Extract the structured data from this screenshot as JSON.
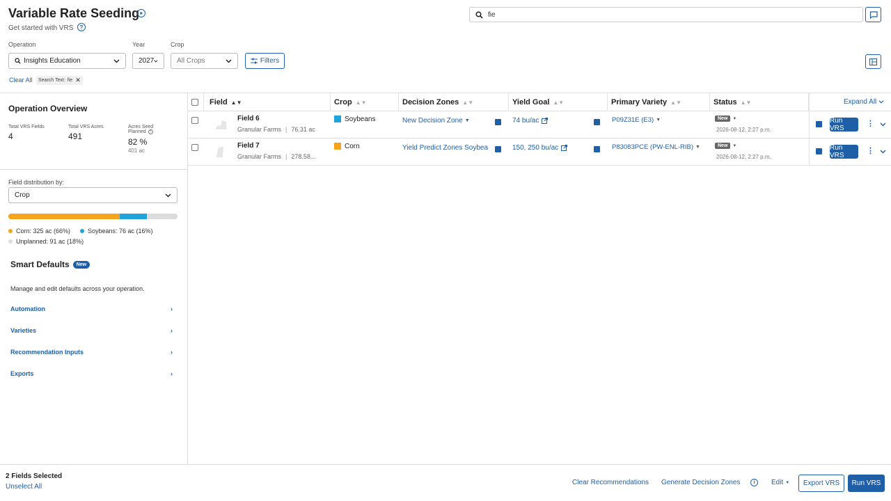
{
  "header": {
    "title": "Variable Rate Seeding",
    "subtitle": "Get started with VRS",
    "search_value": "fie"
  },
  "filters": {
    "operation_label": "Operation",
    "operation_value": "Insights Education",
    "year_label": "Year",
    "year_value": "2027",
    "crop_label": "Crop",
    "crop_value": "All Crops",
    "filters_button": "Filters",
    "clear_all": "Clear All",
    "chip_label": "Search Text:",
    "chip_value": "fie"
  },
  "overview": {
    "title": "Operation Overview",
    "stats": [
      {
        "label": "Total VRS Fields",
        "value": "4",
        "sub": ""
      },
      {
        "label": "Total VRS Acres",
        "value": "491",
        "sub": ""
      },
      {
        "label_1": "Acres Seed",
        "label_2": "Planned",
        "value": "82 %",
        "sub": "401 ac"
      }
    ],
    "dist_label": "Field distribution by:",
    "dist_value": "Crop",
    "distribution": {
      "corn_fraction": 0.66,
      "soybeans_fraction": 0.16,
      "unplanned_fraction": 0.18,
      "corn_color": "#f5a41c",
      "soy_color": "#1fa3d8",
      "unplanned_color": "#dcdcdc"
    },
    "legend": [
      "Corn: 325 ac (66%)",
      "Soybeans: 76 ac (16%)",
      "Unplanned: 91 ac (18%)"
    ]
  },
  "smart_defaults": {
    "title": "Smart Defaults",
    "badge": "New",
    "description": "Manage and edit defaults across your operation.",
    "items": [
      "Automation",
      "Varieties",
      "Recommendation Inputs",
      "Exports"
    ]
  },
  "table": {
    "columns": [
      "Field",
      "Crop",
      "Decision Zones",
      "Yield Goal",
      "Primary Variety",
      "Status"
    ],
    "expand_all": "Expand All",
    "rows": [
      {
        "field": "Field 6",
        "farm": "Granular Farms",
        "acres": "76.31 ac",
        "crop": "Soybeans",
        "crop_color": "#1fa3d8",
        "zone": "New Decision Zone",
        "yield": "74 bu/ac",
        "variety": "P09Z31E (E3)",
        "status": "New",
        "date": "2026-08-12, 2:27 p.m.",
        "run": "Run VRS"
      },
      {
        "field": "Field 7",
        "farm": "Granular Farms",
        "acres": "278.58...",
        "crop": "Corn",
        "crop_color": "#f5a41c",
        "zone": "Yield Predict Zones Soybea",
        "yield": "150, 250 bu/ac",
        "variety": "P83083PCE (PW-ENL-RIB)",
        "status": "New",
        "date": "2026-08-12, 2:27 p.m.",
        "run": "Run VRS"
      }
    ]
  },
  "footer": {
    "selected": "2 Fields Selected",
    "unselect": "Unselect All",
    "clear_recs": "Clear Recommendations",
    "gen_zones": "Generate Decision Zones",
    "edit": "Edit",
    "export": "Export VRS",
    "run": "Run VRS"
  }
}
